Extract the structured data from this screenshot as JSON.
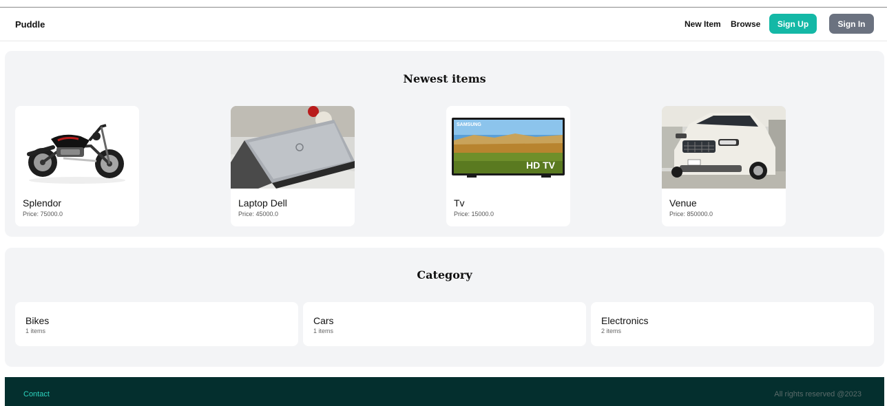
{
  "nav": {
    "brand": "Puddle",
    "links": [
      "New Item",
      "Browse"
    ],
    "signup_label": "Sign Up",
    "signin_label": "Sign In"
  },
  "newest": {
    "title": "Newest items",
    "items": [
      {
        "name": "Splendor",
        "price": "Price: 75000.0",
        "image": "motorcycle"
      },
      {
        "name": "Laptop Dell",
        "price": "Price: 45000.0",
        "image": "laptop"
      },
      {
        "name": "Tv",
        "price": "Price: 15000.0",
        "image": "television",
        "brand": "SAMSUNG",
        "badge": "HD TV"
      },
      {
        "name": "Venue",
        "price": "Price: 850000.0",
        "image": "suv-car"
      }
    ]
  },
  "category": {
    "title": "Category",
    "items": [
      {
        "name": "Bikes",
        "count": "1 items"
      },
      {
        "name": "Cars",
        "count": "1 items"
      },
      {
        "name": "Electronics",
        "count": "2 items"
      }
    ]
  },
  "footer": {
    "contact": "Contact",
    "rights": "All rights reserved @2023"
  },
  "colors": {
    "accent": "#14b8a6",
    "secondary_button": "#6b7280",
    "footer_bg": "#042f2e",
    "footer_link": "#2dd4bf",
    "panel_bg": "#f3f4f6"
  }
}
